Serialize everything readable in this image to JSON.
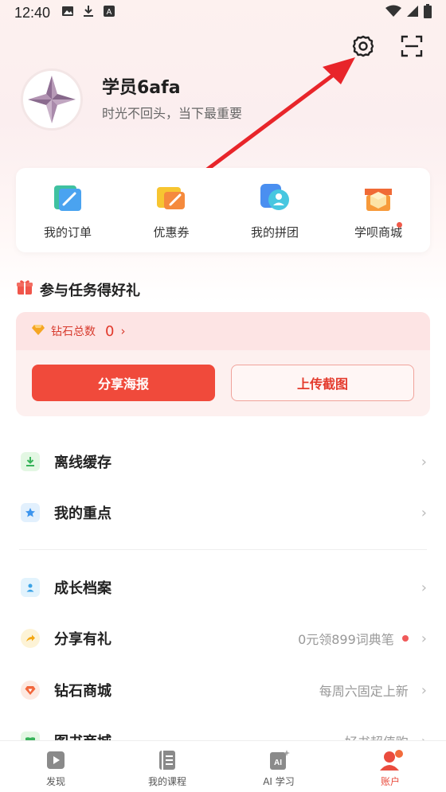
{
  "status_bar": {
    "time": "12:40"
  },
  "profile": {
    "name": "学员6afa",
    "motto": "时光不回头，当下最重要"
  },
  "quick_actions": [
    {
      "label": "我的订单",
      "icon": "orders-icon"
    },
    {
      "label": "优惠券",
      "icon": "coupon-icon"
    },
    {
      "label": "我的拼团",
      "icon": "group-buy-icon"
    },
    {
      "label": "学呗商城",
      "icon": "shop-icon",
      "has_dot": true
    }
  ],
  "tasks": {
    "title": "参与任务得好礼",
    "diamond_label": "钻石总数",
    "diamond_count": "0",
    "share_poster_label": "分享海报",
    "upload_screenshot_label": "上传截图"
  },
  "menu": [
    {
      "label": "离线缓存",
      "icon": "download-icon",
      "right_text": ""
    },
    {
      "label": "我的重点",
      "icon": "star-icon",
      "right_text": ""
    },
    {
      "label": "成长档案",
      "icon": "profile-file-icon",
      "right_text": ""
    },
    {
      "label": "分享有礼",
      "icon": "share-arrow-icon",
      "right_text": "0元领899词典笔",
      "has_dot": true
    },
    {
      "label": "钻石商城",
      "icon": "diamond-shop-icon",
      "right_text": "每周六固定上新"
    },
    {
      "label": "图书商城",
      "icon": "book-shop-icon",
      "right_text": "好书超值购"
    }
  ],
  "tabs": [
    {
      "label": "发现",
      "icon": "discover-icon"
    },
    {
      "label": "我的课程",
      "icon": "courses-icon"
    },
    {
      "label": "AI 学习",
      "icon": "ai-learning-icon"
    },
    {
      "label": "账户",
      "icon": "account-icon",
      "active": true
    }
  ],
  "colors": {
    "accent": "#f04a3b",
    "annotation_arrow": "#e8252a"
  }
}
